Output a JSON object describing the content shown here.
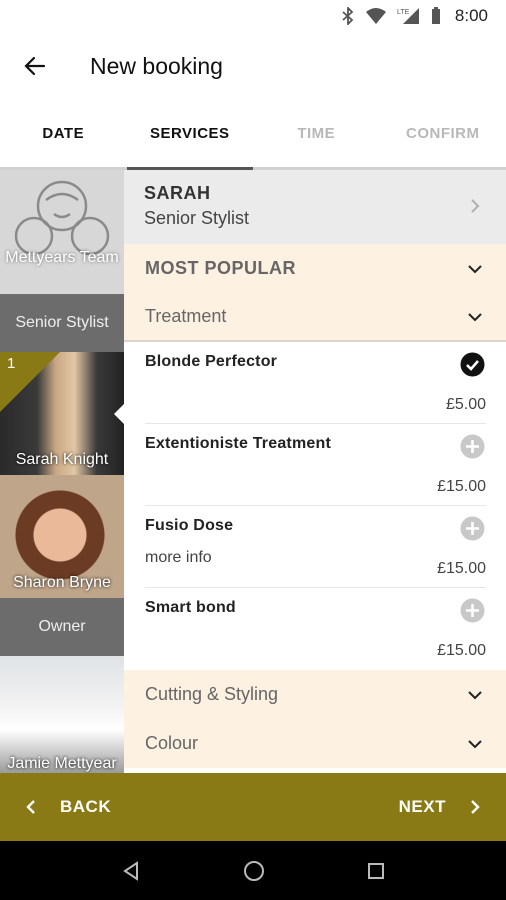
{
  "status_bar": {
    "time": "8:00",
    "network_label": "LTE"
  },
  "header": {
    "title": "New booking"
  },
  "tabs": [
    {
      "label": "DATE",
      "state": "done"
    },
    {
      "label": "SERVICES",
      "state": "active"
    },
    {
      "label": "TIME",
      "state": "disabled"
    },
    {
      "label": "CONFIRM",
      "state": "disabled"
    }
  ],
  "staff": {
    "team_label": "Mettyears Team",
    "groups": [
      {
        "role": "Senior Stylist"
      },
      {
        "role": "Owner"
      }
    ],
    "members": [
      {
        "name": "Sarah Knight",
        "badge": "1"
      },
      {
        "name": "Sharon Bryne"
      },
      {
        "name": "Jamie Mettyear"
      }
    ]
  },
  "stylist": {
    "name": "SARAH",
    "role": "Senior Stylist"
  },
  "categories": {
    "most_popular": "MOST POPULAR",
    "treatment": "Treatment",
    "cutting": "Cutting & Styling",
    "colour": "Colour"
  },
  "services": [
    {
      "name": "Blonde Perfector",
      "price": "£5.00",
      "selected": true
    },
    {
      "name": "Extentioniste Treatment",
      "price": "£15.00",
      "selected": false
    },
    {
      "name": "Fusio Dose",
      "price": "£15.00",
      "extra": "more info",
      "selected": false
    },
    {
      "name": "Smart bond",
      "price": "£15.00",
      "selected": false
    }
  ],
  "footer": {
    "back_label": "BACK",
    "next_label": "NEXT"
  },
  "colors": {
    "accent": "#8a7a16",
    "category_bg": "#fdf1e2"
  }
}
